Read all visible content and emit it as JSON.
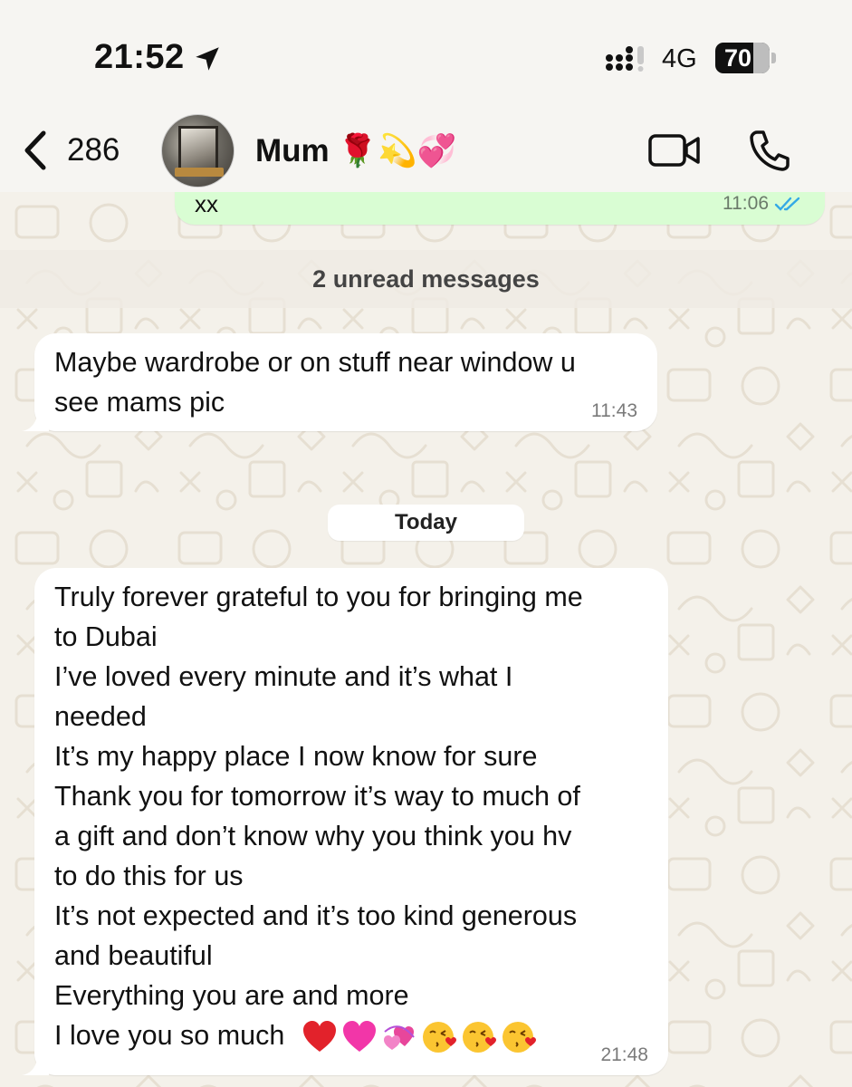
{
  "status_bar": {
    "time": "21:52",
    "network": "4G",
    "battery_level": "70",
    "battery_fraction": 0.7
  },
  "header": {
    "back_count": "286",
    "contact_name": "Mum 🌹💫💞"
  },
  "colors": {
    "outgoing_bubble": "#d9fdd3",
    "incoming_bubble": "#ffffff",
    "read_ticks": "#34a9e6",
    "wallpaper": "#f4f1ea"
  },
  "messages": {
    "outgoing": {
      "text": "xx",
      "time": "11:06",
      "status_icon": "double-check-read-icon"
    },
    "unread_banner": "2 unread messages",
    "incoming_1": {
      "lines": [
        "Maybe wardrobe or on stuff near window u",
        "see mams pic"
      ],
      "time": "11:43"
    },
    "date_separator": "Today",
    "incoming_2": {
      "lines": [
        "Truly forever grateful to you for bringing me",
        "to Dubai",
        "I’ve loved every minute and it’s what I",
        "needed",
        "It’s my happy place I now know for sure",
        "Thank you for tomorrow it’s way to much of",
        "a gift and don’t know why you think you hv",
        "to do this for us",
        "It’s not expected and it’s too kind generous",
        "and beautiful",
        "Everything you are and more",
        "I love you so much"
      ],
      "emojis": [
        "red-heart-icon",
        "pink-heart-icon",
        "revolving-hearts-icon",
        "kissing-face-icon",
        "kissing-face-icon",
        "kissing-face-icon"
      ],
      "time": "21:48"
    }
  }
}
